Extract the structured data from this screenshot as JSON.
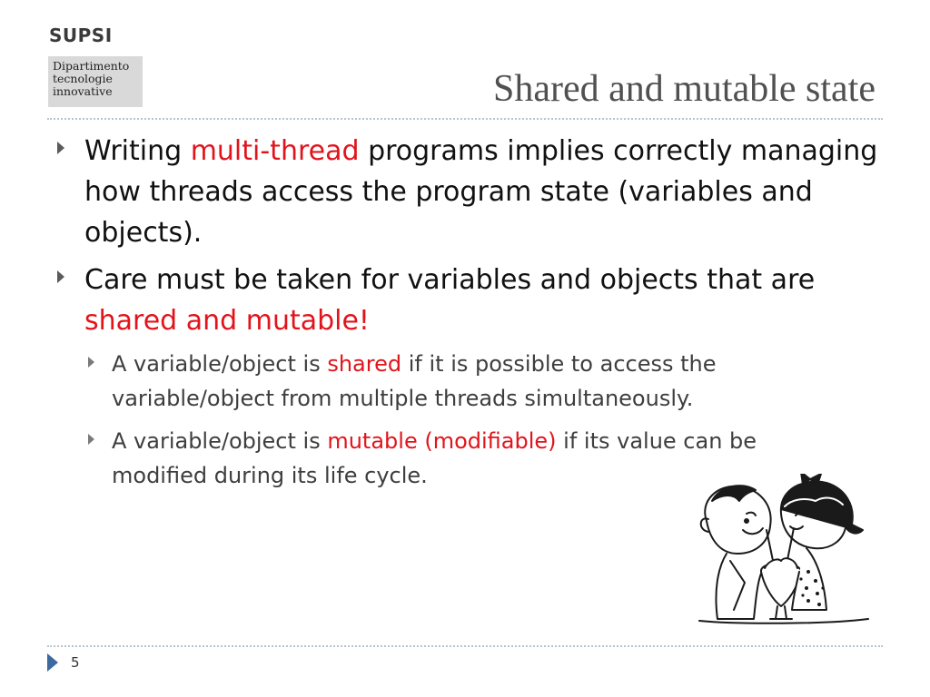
{
  "header": {
    "logo": "SUPSI",
    "department": [
      "Dipartimento",
      "tecnologie",
      "innovative"
    ],
    "title": "Shared and mutable state"
  },
  "bullets": [
    {
      "parts": [
        {
          "text": "Writing ",
          "red": false
        },
        {
          "text": "multi-thread",
          "red": true
        },
        {
          "text": " programs implies correctly managing how threads access the program state (variables and objects).",
          "red": false
        }
      ]
    },
    {
      "parts": [
        {
          "text": "Care must be taken for variables and objects that are ",
          "red": false
        },
        {
          "text": "shared and mutable!",
          "red": true
        }
      ],
      "sub": [
        {
          "parts": [
            {
              "text": "A variable/object is ",
              "red": false
            },
            {
              "text": "shared",
              "red": true
            },
            {
              "text": " if it is possible to access the variable/object from multiple threads simultaneously.",
              "red": false
            }
          ]
        },
        {
          "parts": [
            {
              "text": "A variable/object is ",
              "red": false
            },
            {
              "text": "mutable (modifiable)",
              "red": true
            },
            {
              "text": " if its value can be modified during its life cycle.",
              "red": false
            }
          ]
        }
      ]
    }
  ],
  "footer": {
    "page_number": "5",
    "nav_icon": "triangle-right-icon"
  },
  "illustration": {
    "icon": "children-sharing-milkshake-drawing"
  },
  "colors": {
    "accent_red": "#e1141c",
    "rule": "#b7c4cf",
    "footer_arrow": "#3a6aa0"
  }
}
